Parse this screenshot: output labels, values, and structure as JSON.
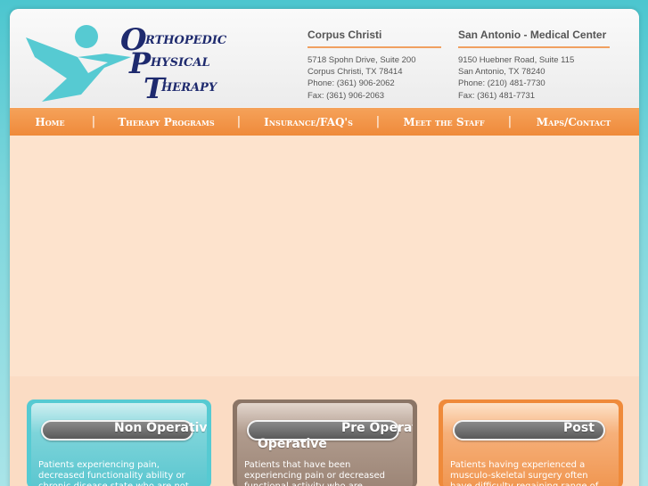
{
  "logo": {
    "text": "Orthopedic Physical Therapy",
    "letters": [
      "O",
      "P",
      "T"
    ],
    "words": [
      "RTHOPEDIC",
      "HYSICAL",
      "HERAPY"
    ]
  },
  "locations": [
    {
      "city": "Corpus Christi",
      "address": "5718 Spohn Drive, Suite 200",
      "citystate": "Corpus Christi, TX 78414",
      "phone": "Phone: (361) 906-2062",
      "fax": "Fax: (361) 906-2063"
    },
    {
      "city": "San Antonio - Medical Center",
      "address": "9150 Huebner Road, Suite 115",
      "citystate": "San Antonio, TX 78240",
      "phone": "Phone: (210) 481-7730",
      "fax": "Fax: (361) 481-7731"
    }
  ],
  "nav": [
    "Home",
    "Therapy Programs",
    "Insurance/FAQ's",
    "Meet the Staff",
    "Maps/Contact"
  ],
  "cards": [
    {
      "title": "Non Operative",
      "text": "Patients experiencing pain, decreased functionality ability or chronic disease state who are not surgery candidates"
    },
    {
      "title": "Pre Operative",
      "title2": "Operative",
      "text": "Patients that have been experiencing pain or decreased functional activity who are considering surgery as an option"
    },
    {
      "title": "Post",
      "text": "Patients having experienced a musculo-skeletal surgery often have difficulty regaining range of motion and strength"
    }
  ],
  "colors": {
    "teal": "#56cad2",
    "orange": "#ef8a3a",
    "brown": "#8b7566",
    "navy": "#1e2a6e"
  }
}
